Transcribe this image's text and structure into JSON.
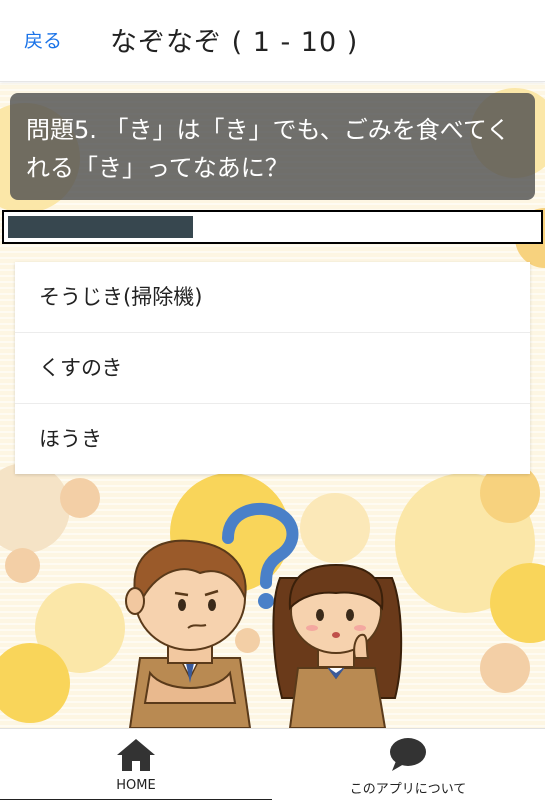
{
  "header": {
    "back_label": "戻る",
    "title": "なぞなぞ ( 1 - 10 )"
  },
  "question": {
    "text": "問題5. 「き」は「き」でも、ごみを食べてくれる「き」ってなあに？"
  },
  "progress": {
    "fraction": 0.35
  },
  "choices": [
    {
      "label": "そうじき(掃除機)"
    },
    {
      "label": "くすのき"
    },
    {
      "label": "ほうき"
    }
  ],
  "bottom_nav": {
    "items": [
      {
        "label": "HOME",
        "icon": "home-icon"
      },
      {
        "label": "このアプリについて",
        "icon": "chat-bubble-icon"
      }
    ]
  },
  "colors": {
    "accent": "#1a73e8",
    "question_bg": "#505050",
    "progress_fill": "#37474f",
    "background": "#fdf6e3",
    "dots": "#f9d55a"
  }
}
